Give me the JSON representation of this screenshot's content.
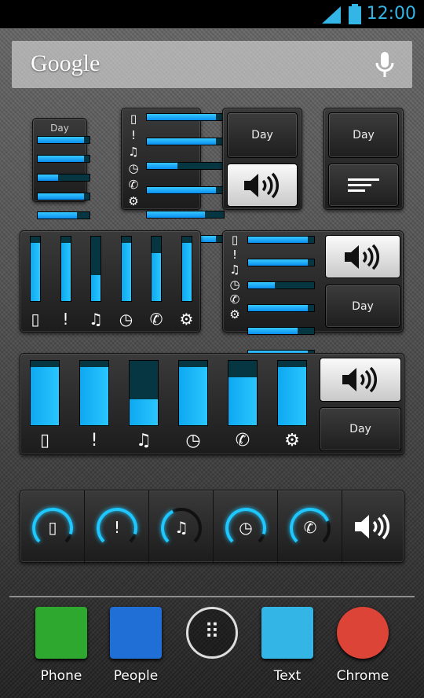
{
  "status_bar": {
    "time": "12:00",
    "icons": [
      "signal-icon",
      "battery-icon"
    ]
  },
  "search": {
    "logo": "Google",
    "icon": "microphone-icon"
  },
  "widgets": {
    "day_label": "Day",
    "streams": [
      {
        "name": "ringer",
        "icon": "ringer-icon",
        "glyph": "▯",
        "level": 0.9
      },
      {
        "name": "notification",
        "icon": "notification-icon",
        "glyph": "!",
        "level": 0.9
      },
      {
        "name": "music",
        "icon": "music-icon",
        "glyph": "♫",
        "level": 0.4
      },
      {
        "name": "alarm",
        "icon": "alarm-icon",
        "glyph": "◷",
        "level": 0.9
      },
      {
        "name": "call",
        "icon": "phone-icon",
        "glyph": "✆",
        "level": 0.75
      },
      {
        "name": "system",
        "icon": "gear-icon",
        "glyph": "⚙",
        "level": 0.9
      }
    ],
    "accent": "#1ec8ff"
  },
  "dock": [
    {
      "label": "Phone",
      "color": "#2ea82e"
    },
    {
      "label": "People",
      "color": "#1f6fd6"
    },
    {
      "label": "",
      "icon": "app-drawer-icon"
    },
    {
      "label": "Text",
      "color": "#33b5e5"
    },
    {
      "label": "Chrome",
      "color": "#db4437"
    }
  ]
}
